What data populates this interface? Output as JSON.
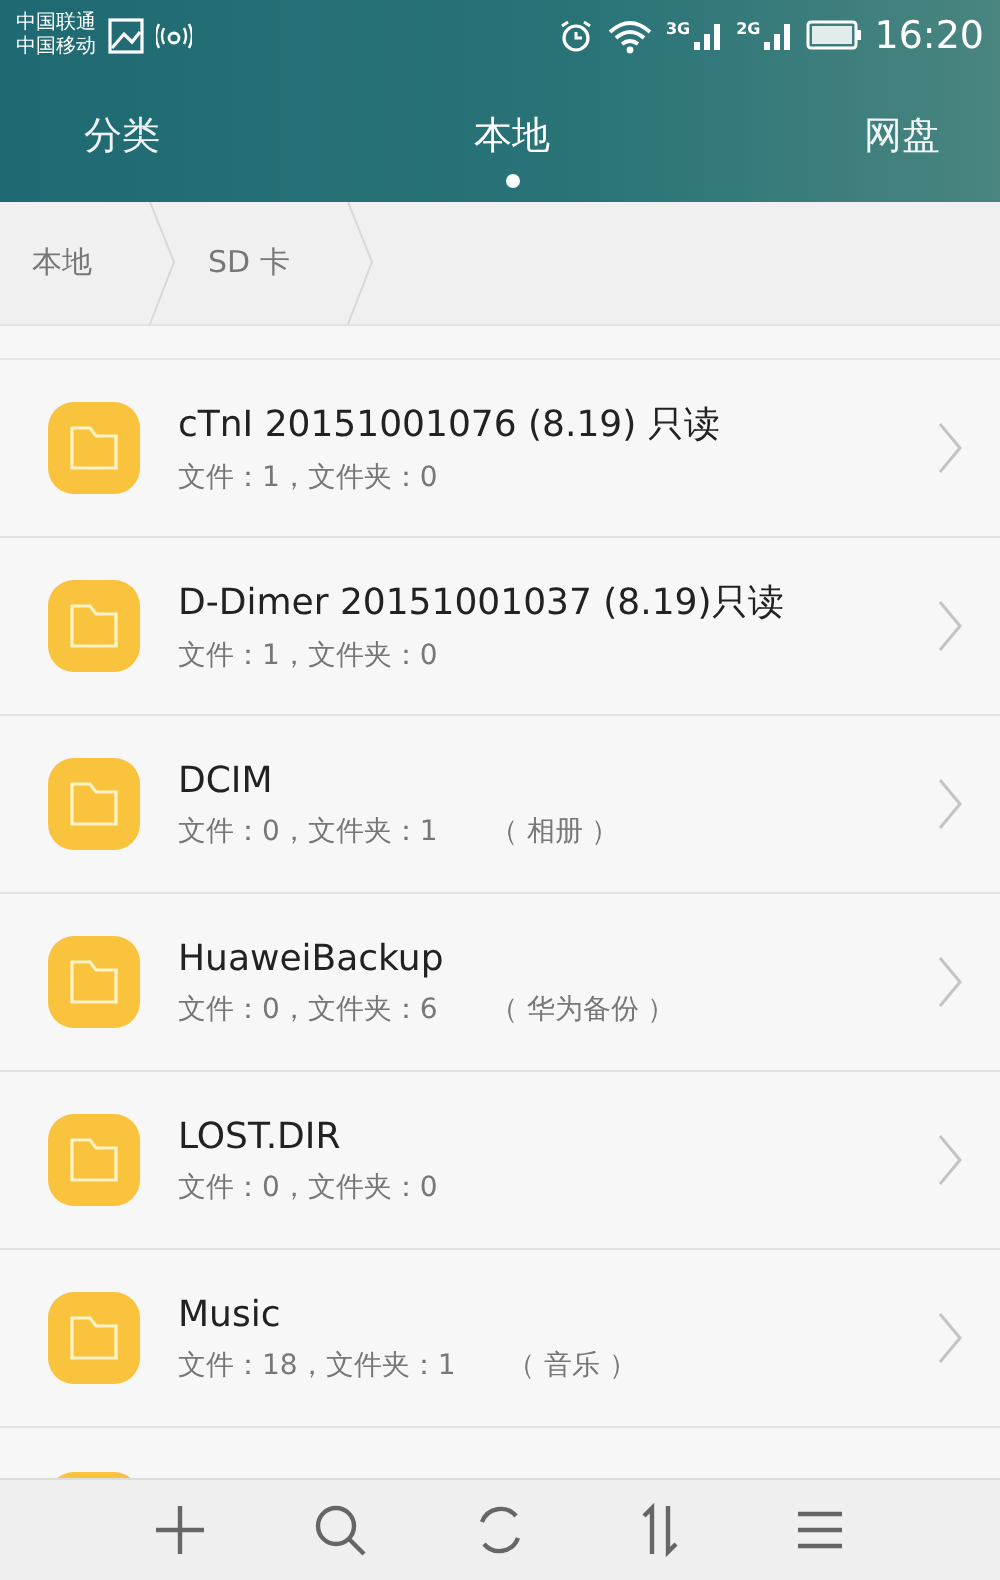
{
  "status_bar": {
    "carriers": [
      "中国联通",
      "中国移动"
    ],
    "network_labels": [
      "3G",
      "2G"
    ],
    "time": "16:20"
  },
  "tabs": [
    {
      "label": "分类",
      "selected": false
    },
    {
      "label": "本地",
      "selected": true
    },
    {
      "label": "网盘",
      "selected": false
    }
  ],
  "breadcrumb": [
    "本地",
    "SD 卡"
  ],
  "folders": [
    {
      "name": "cTnI 20151001076 (8.19) 只读",
      "meta": "文件：1，文件夹：0"
    },
    {
      "name": "D-Dimer 20151001037 (8.19)只读",
      "meta": "文件：1，文件夹：0"
    },
    {
      "name": "DCIM",
      "meta": "文件：0，文件夹：1",
      "note": "（ 相册 ）"
    },
    {
      "name": "HuaweiBackup",
      "meta": "文件：0，文件夹：6",
      "note": "（ 华为备份 ）"
    },
    {
      "name": "LOST.DIR",
      "meta": "文件：0，文件夹：0"
    },
    {
      "name": "Music",
      "meta": "文件：18，文件夹：1",
      "note": "（ 音乐 ）"
    }
  ]
}
